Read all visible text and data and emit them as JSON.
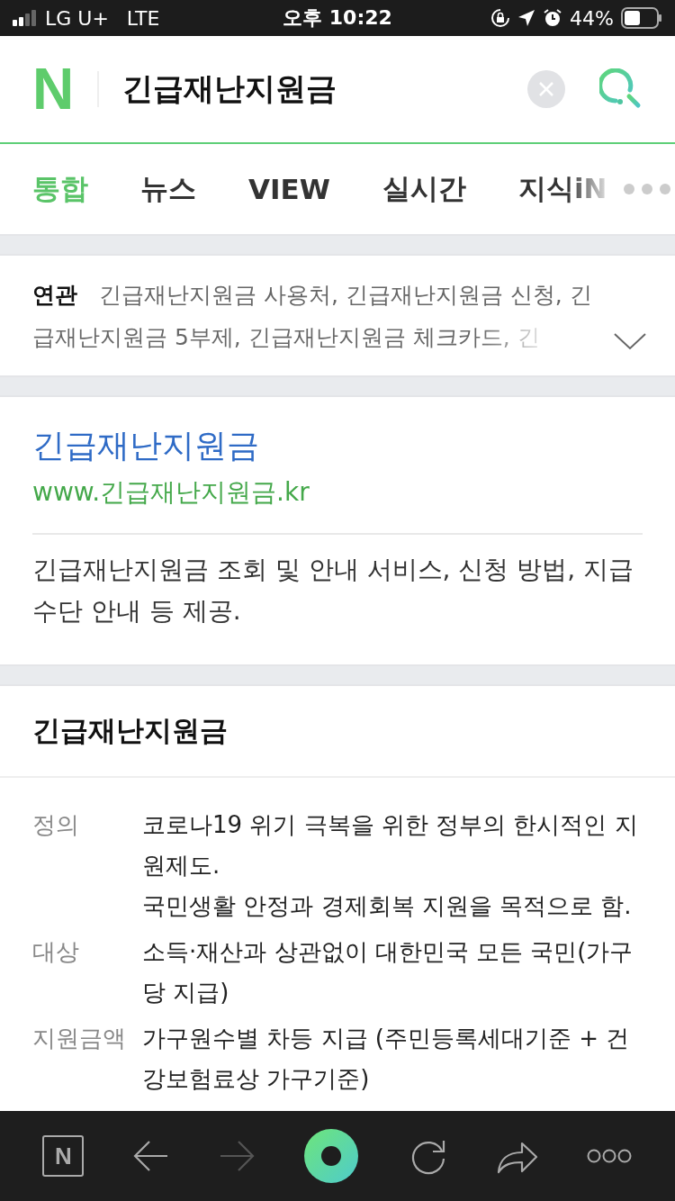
{
  "status_bar": {
    "carrier": "LG U+",
    "network": "LTE",
    "time": "오후 10:22",
    "battery": "44%"
  },
  "search_bar": {
    "logo": "N",
    "query": "긴급재난지원금"
  },
  "tabs": [
    {
      "label": "통합",
      "selected": true
    },
    {
      "label": "뉴스",
      "selected": false
    },
    {
      "label": "VIEW",
      "selected": false
    },
    {
      "label": "실시간",
      "selected": false
    },
    {
      "label": "지식iN",
      "selected": false
    }
  ],
  "related": {
    "label": "연관",
    "lines": [
      "긴급재난지원금 사용처, 긴급재난지원금 신청, 긴",
      "급재난지원금 5부제, 긴급재난지원금 체크카드, 긴"
    ]
  },
  "site_result": {
    "title": "긴급재난지원금",
    "url": "www.긴급재난지원금.kr",
    "description": "긴급재난지원금 조회 및 안내 서비스, 신청 방법, 지급 수단 안내 등 제공."
  },
  "knowledge": {
    "title": "긴급재난지원금",
    "rows": [
      {
        "term": "정의",
        "lines": [
          "코로나19 위기 극복을 위한 정부의 한시적인 지원제도.",
          "국민생활 안정과 경제회복 지원을 목적으로 함."
        ]
      },
      {
        "term": "대상",
        "lines": [
          "소득·재산과 상관없이 대한민국 모든 국민(가구당 지급)"
        ]
      },
      {
        "term": "지원금액",
        "lines": [
          "가구원수별 차등 지급 (주민등록세대기준 + 건강보험료상 가구기준)"
        ]
      }
    ]
  },
  "toolbar": {
    "home_logo": "N"
  }
}
